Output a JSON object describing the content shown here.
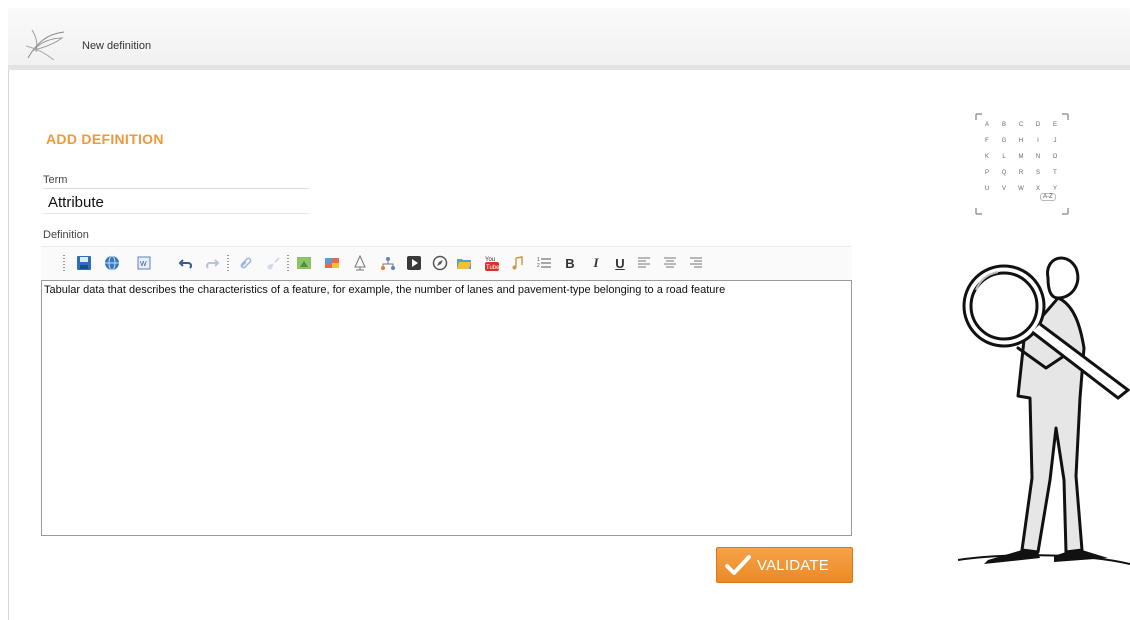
{
  "header": {
    "title": "New definition",
    "logo_icon": "leaf-logo-icon"
  },
  "form": {
    "heading": "ADD DEFINITION",
    "term_label": "Term",
    "term_value": "Attribute",
    "definition_label": "Definition",
    "definition_text": "Tabular data that describes the characteristics of a feature, for example, the number of lanes and pavement-type belonging to a road feature",
    "validate_label": "VALIDATE"
  },
  "toolbar": {
    "buttons": [
      "save-icon",
      "globe-icon",
      "word-paste-icon",
      "undo-icon",
      "redo-icon",
      "link-icon",
      "unlink-icon",
      "image-icon",
      "gallery-icon",
      "tree-icon",
      "sitemap-icon",
      "video-icon",
      "compass-icon",
      "folder-icon",
      "youtube-icon",
      "music-icon",
      "list-icon",
      "bold-icon",
      "italic-icon",
      "underline-icon",
      "align-left-icon",
      "align-center-icon",
      "align-right-icon"
    ]
  },
  "alphabet_index": {
    "letters": [
      "A",
      "B",
      "C",
      "D",
      "E",
      "F",
      "G",
      "H",
      "I",
      "J",
      "K",
      "L",
      "M",
      "N",
      "O",
      "P",
      "Q",
      "R",
      "S",
      "T",
      "U",
      "V",
      "W",
      "X",
      "Y"
    ],
    "button_label": "A-Z"
  },
  "colors": {
    "accent": "#ee9a3c",
    "button": "#ec8a24"
  }
}
